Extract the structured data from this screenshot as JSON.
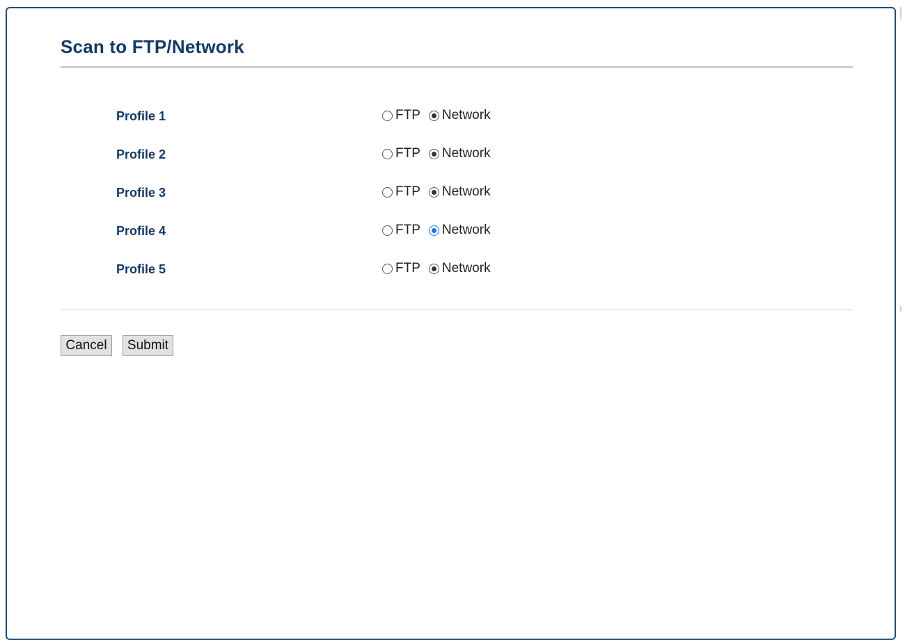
{
  "page": {
    "title": "Scan to FTP/Network"
  },
  "profiles": [
    {
      "label": "Profile 1",
      "options": [
        "FTP",
        "Network"
      ],
      "selected": "Network",
      "focused": false
    },
    {
      "label": "Profile 2",
      "options": [
        "FTP",
        "Network"
      ],
      "selected": "Network",
      "focused": false
    },
    {
      "label": "Profile 3",
      "options": [
        "FTP",
        "Network"
      ],
      "selected": "Network",
      "focused": false
    },
    {
      "label": "Profile 4",
      "options": [
        "FTP",
        "Network"
      ],
      "selected": "Network",
      "focused": true
    },
    {
      "label": "Profile 5",
      "options": [
        "FTP",
        "Network"
      ],
      "selected": "Network",
      "focused": false
    }
  ],
  "buttons": {
    "cancel_label": "Cancel",
    "submit_label": "Submit"
  },
  "colors": {
    "title": "#143a64",
    "panel_border": "#1f4e79",
    "focus_accent": "#1a73e8"
  }
}
